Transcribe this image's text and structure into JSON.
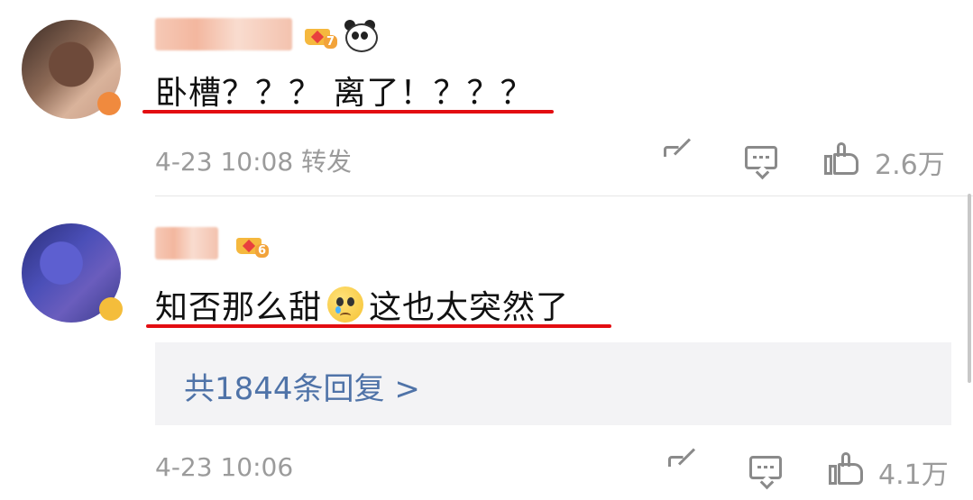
{
  "comments": [
    {
      "username": "",
      "level": "7",
      "text": "卧槽？？？ 离了！？？？",
      "timestamp": "4-23 10:08",
      "forward_label": "转发",
      "likes": "2.6万"
    },
    {
      "username": "",
      "level": "6",
      "text_before_emoji": "知否那么甜",
      "text_after_emoji": "这也太突然了",
      "replies_label": "共1844条回复 >",
      "timestamp": "4-23 10:06",
      "likes": "4.1万"
    }
  ],
  "icons": {
    "vip_badge": "crown-icon",
    "fan_badge": "panda-icon",
    "emoji": "crying-face-emoji",
    "share": "share-icon",
    "comment": "comment-icon",
    "like": "thumbs-up-icon"
  },
  "colors": {
    "underline": "#e30d11",
    "link": "#4f73a8",
    "meta": "#9b9b9b",
    "reply_box_bg": "#f3f3f5"
  }
}
